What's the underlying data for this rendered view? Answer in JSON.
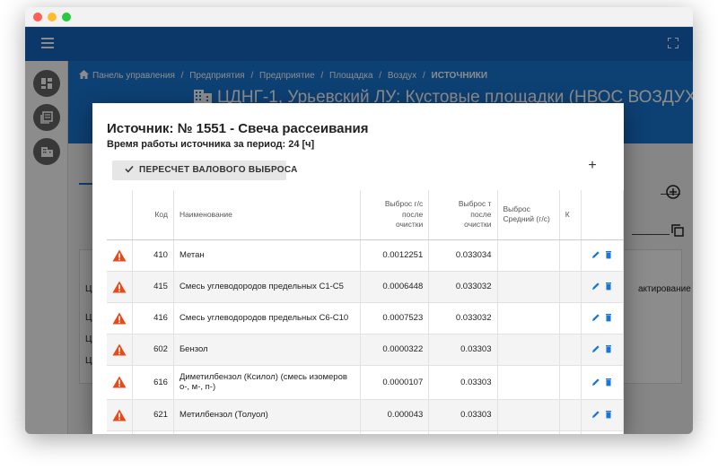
{
  "window": {
    "colors": {
      "appbar": "#1565c0",
      "hero": "#1976d2",
      "warning": "#e64a19",
      "action": "#1976d2"
    }
  },
  "appbar": {
    "menu_icon": "hamburger-menu-icon",
    "fullscreen_icon": "fullscreen-icon"
  },
  "sidebar": {
    "icons": [
      "dashboard-icon",
      "library-icon",
      "building-icon"
    ]
  },
  "breadcrumb": {
    "home_icon": "home-icon",
    "items": [
      "Панель управления",
      "Предприятия",
      "Предприятие",
      "Площадка",
      "Воздух"
    ],
    "separator": "/",
    "current": "ИСТОЧНИКИ"
  },
  "page": {
    "title": "ЦДНГ-1, Урьевский ЛУ: Кустовые площадки (НВОС ВОЗДУХ)",
    "title_icon": "building-icon"
  },
  "background_table": {
    "peek_header_left": "Ц",
    "peek_header_right": "актирование",
    "peek_rows": [
      "Ц",
      "Ц",
      "Ц"
    ]
  },
  "dialog": {
    "title": "Источник: № 1551 - Свеча рассеивания",
    "subtitle": "Время работы источника за период: 24 [ч]",
    "recalc_button": "ПЕРЕСЧЕТ ВАЛОВОГО ВЫБРОСА",
    "add_button": "+",
    "table": {
      "headers": {
        "code": "Код",
        "name": "Наименование",
        "emission_g_line1": "Выброс г/с",
        "emission_g_line2": "после",
        "emission_g_line3": "очистки",
        "emission_t_line1": "Выброс т",
        "emission_t_line2": "после",
        "emission_t_line3": "очистки",
        "avg_line1": "Выброс",
        "avg_line2": "Средний (г/с)",
        "k": "К"
      },
      "rows": [
        {
          "code": "410",
          "name": "Метан",
          "emission_g": "0.0012251",
          "emission_t": "0.033034"
        },
        {
          "code": "415",
          "name": "Смесь углеводородов предельных С1-С5",
          "emission_g": "0.0006448",
          "emission_t": "0.033032"
        },
        {
          "code": "416",
          "name": "Смесь углеводородов предельных С6-С10",
          "emission_g": "0.0007523",
          "emission_t": "0.033032"
        },
        {
          "code": "602",
          "name": "Бензол",
          "emission_g": "0.0000322",
          "emission_t": "0.03303"
        },
        {
          "code": "616",
          "name": "Диметилбензол (Ксилол) (смесь изомеров о-, м-, п-)",
          "emission_g": "0.0000107",
          "emission_t": "0.03303"
        },
        {
          "code": "621",
          "name": "Метилбензол (Толуол)",
          "emission_g": "0.000043",
          "emission_t": "0.03303"
        }
      ]
    }
  }
}
